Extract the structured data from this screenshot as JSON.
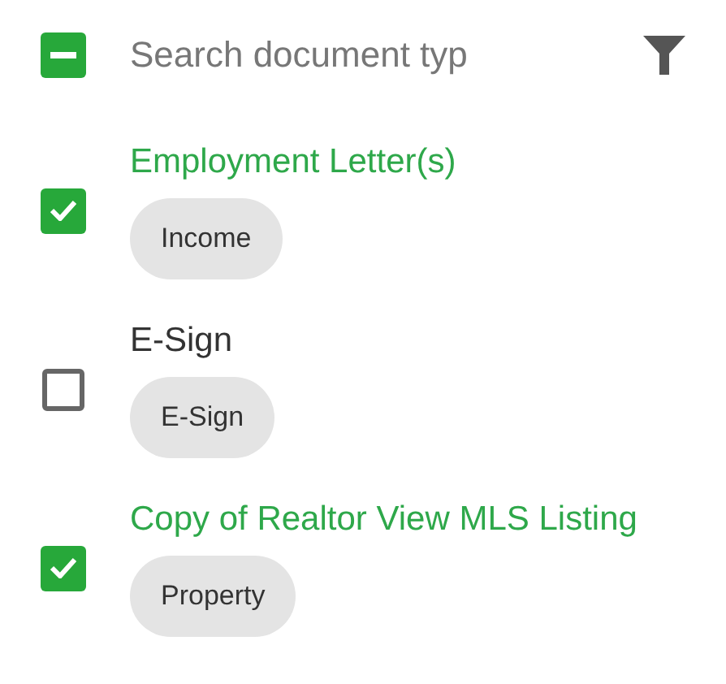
{
  "select_all": {
    "indeterminate": true
  },
  "search": {
    "placeholder": "Search document typ"
  },
  "documents": [
    {
      "title": "Employment Letter(s)",
      "checked": true,
      "tag": "Income"
    },
    {
      "title": "E-Sign",
      "checked": false,
      "tag": "E-Sign"
    },
    {
      "title": "Copy of Realtor View MLS Listing",
      "checked": true,
      "tag": "Property"
    }
  ]
}
